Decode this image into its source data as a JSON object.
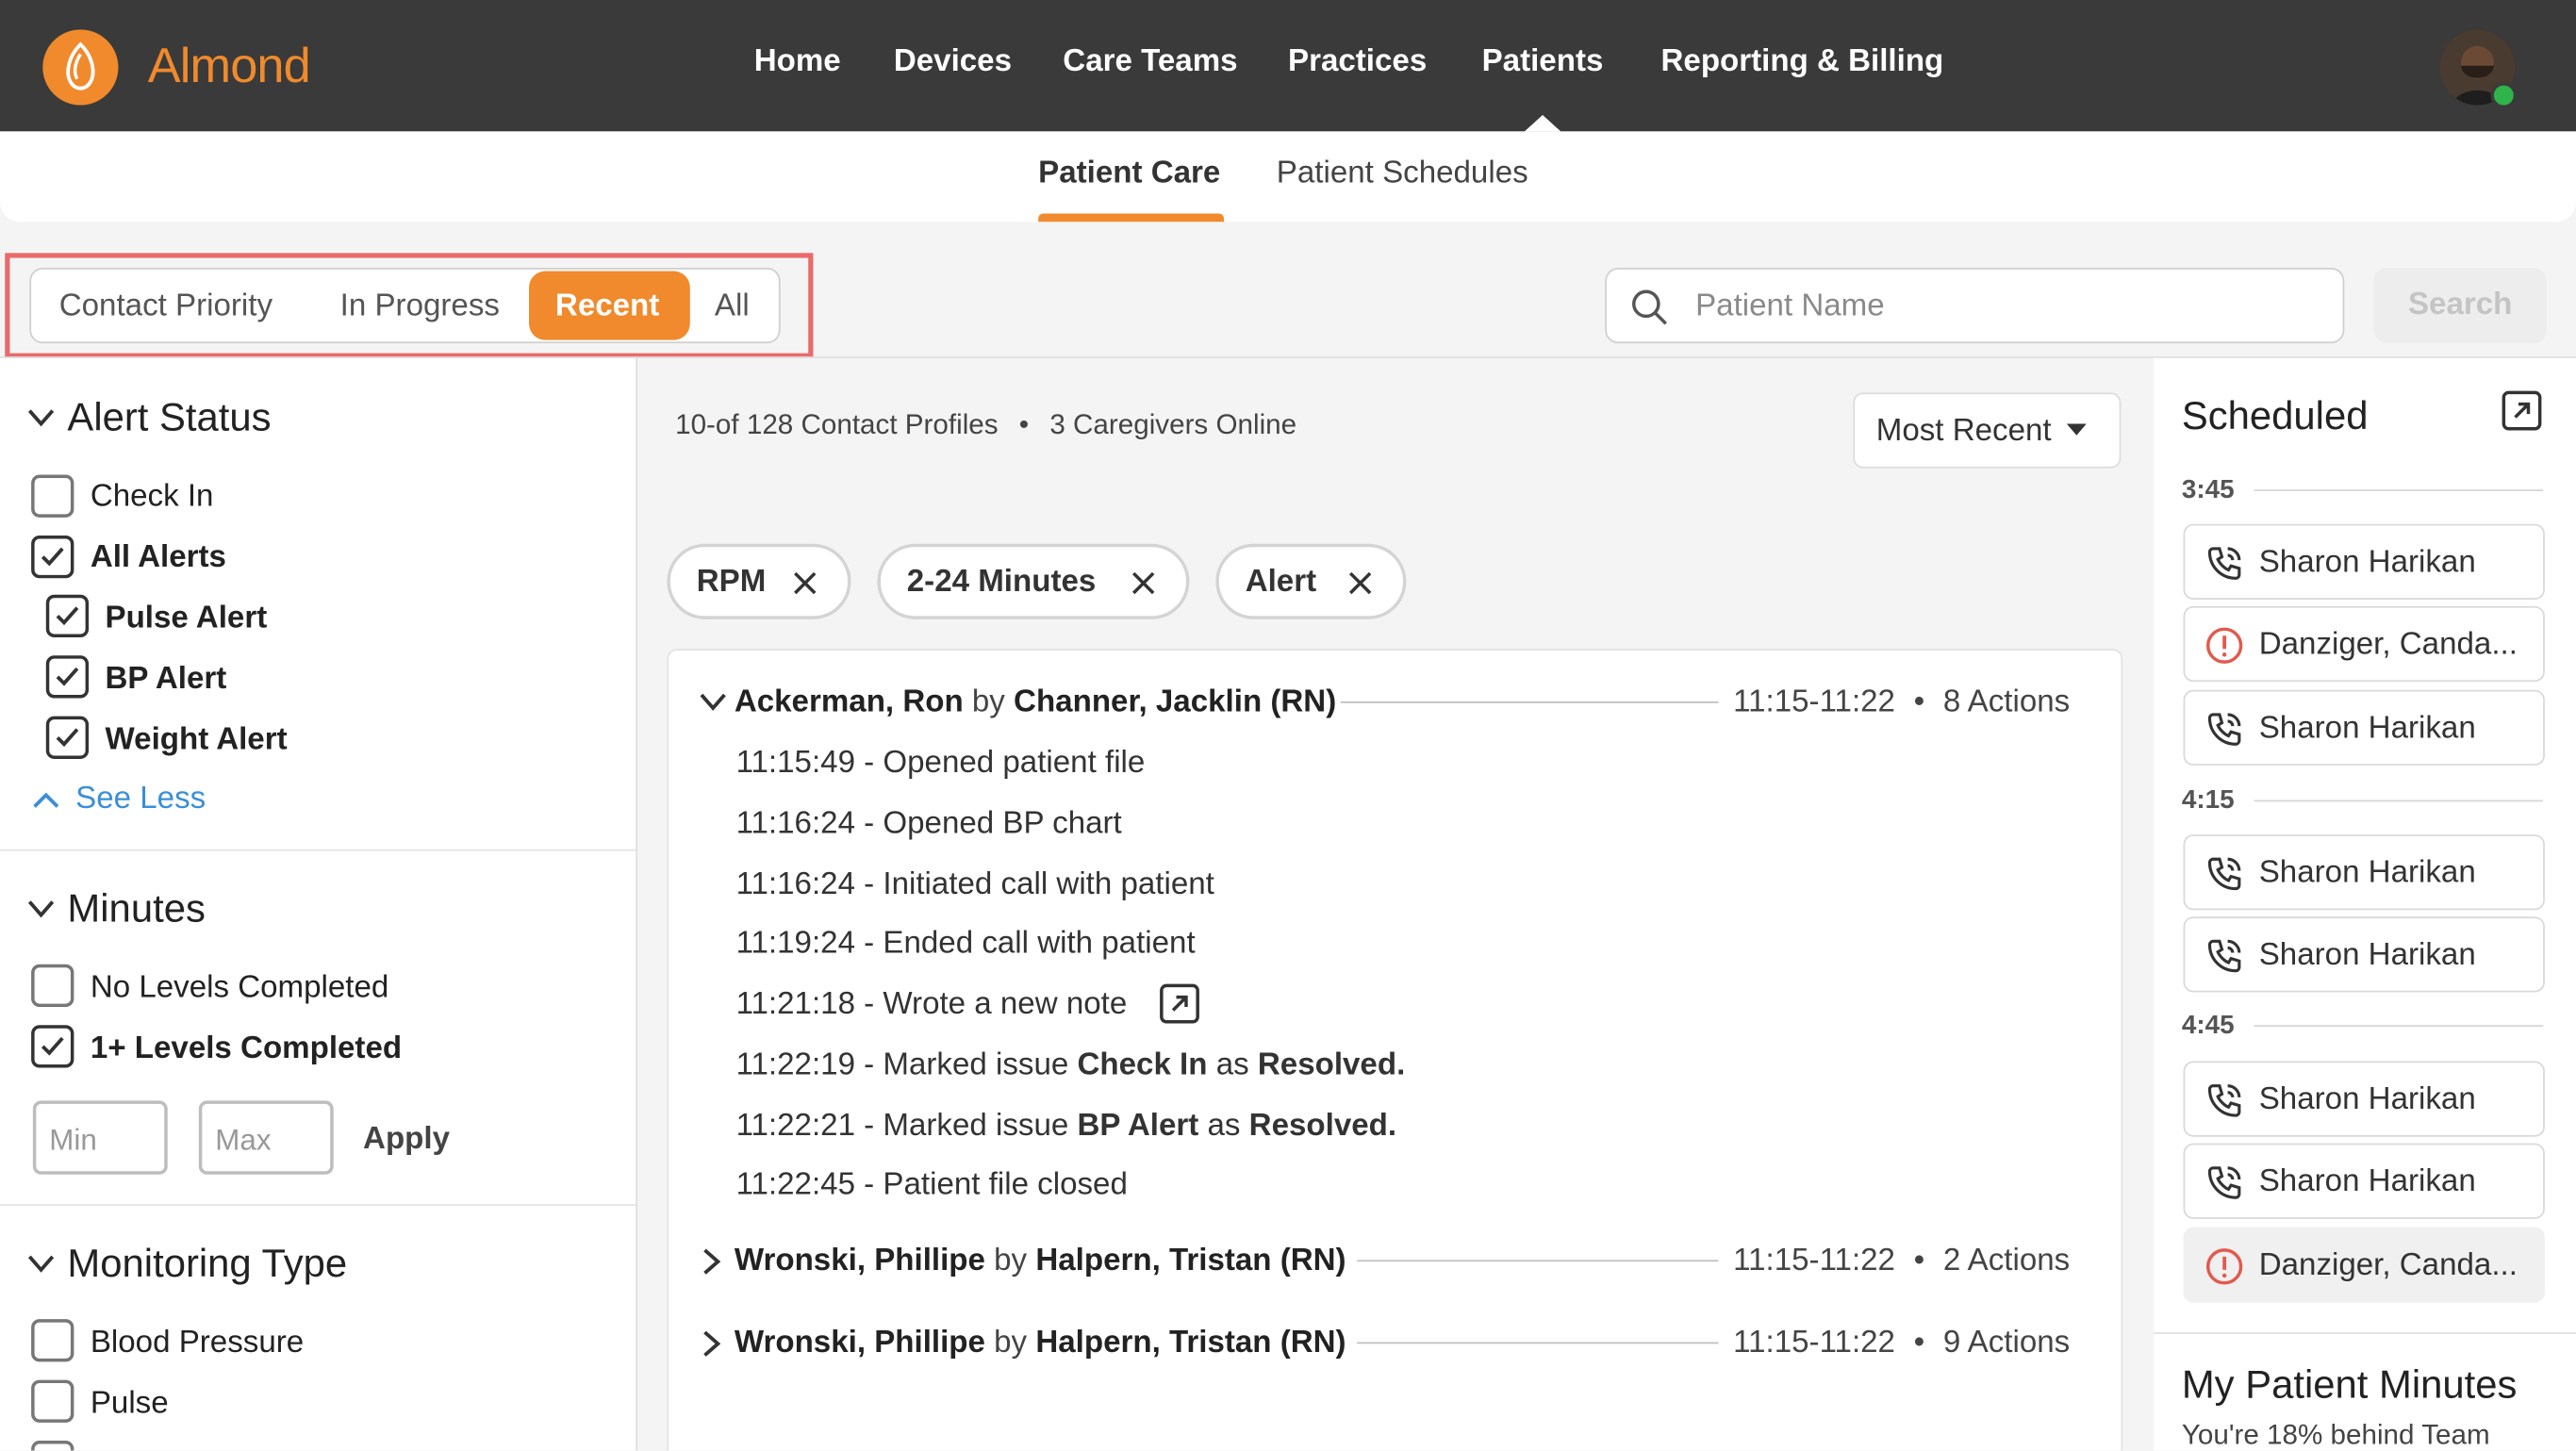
{
  "app": {
    "name": "Almond"
  },
  "nav": {
    "items": [
      "Home",
      "Devices",
      "Care Teams",
      "Practices",
      "Patients",
      "Reporting & Billing"
    ],
    "active": "Patients"
  },
  "subnav": {
    "tabs": [
      "Patient Care",
      "Patient Schedules"
    ],
    "active": "Patient Care"
  },
  "filter_tabs": {
    "items": [
      "Contact Priority",
      "In Progress",
      "Recent",
      "All"
    ],
    "active": "Recent"
  },
  "search": {
    "placeholder": "Patient Name",
    "button": "Search"
  },
  "alert_status": {
    "title": "Alert Status",
    "options": [
      {
        "label": "Check In",
        "checked": false
      },
      {
        "label": "All Alerts",
        "checked": true
      },
      {
        "label": "Pulse Alert",
        "checked": true
      },
      {
        "label": "BP Alert",
        "checked": true
      },
      {
        "label": "Weight Alert",
        "checked": true
      }
    ],
    "toggle": "See Less"
  },
  "minutes": {
    "title": "Minutes",
    "options": [
      {
        "label": "No Levels Completed",
        "checked": false
      },
      {
        "label": "1+ Levels Completed",
        "checked": true
      }
    ],
    "min_placeholder": "Min",
    "max_placeholder": "Max",
    "apply": "Apply"
  },
  "monitoring_type": {
    "title": "Monitoring Type",
    "options": [
      {
        "label": "Blood Pressure",
        "checked": false
      },
      {
        "label": "Pulse",
        "checked": false
      }
    ]
  },
  "summary": {
    "profiles": "10-of 128 Contact Profiles",
    "caregivers": "3 Caregivers Online"
  },
  "sort": {
    "label": "Most Recent"
  },
  "chips": [
    "RPM",
    "2-24 Minutes",
    "Alert"
  ],
  "logs": [
    {
      "patient": "Ackerman, Ron",
      "by": "by",
      "caregiver": "Channer, Jacklin (RN)",
      "time": "11:15-11:22",
      "actions": "8 Actions",
      "expanded": true,
      "entries": [
        {
          "text": "11:15:49 - Opened patient file"
        },
        {
          "text": "11:16:24 - Opened BP chart"
        },
        {
          "text": "11:16:24 - Initiated call with patient"
        },
        {
          "text": "11:19:24 - Ended call with patient"
        },
        {
          "text": "11:21:18 - Wrote a new note"
        },
        {
          "pre": "11:22:19 - Marked issue",
          "issue": "Check In",
          "mid": "as",
          "status": "Resolved."
        },
        {
          "pre": "11:22:21 - Marked issue",
          "issue": "BP Alert",
          "mid": "as",
          "status": "Resolved."
        },
        {
          "text": "11:22:45 - Patient file closed"
        }
      ]
    },
    {
      "patient": "Wronski, Phillipe",
      "by": "by",
      "caregiver": "Halpern, Tristan (RN)",
      "time": "11:15-11:22",
      "actions": "2 Actions",
      "expanded": false
    },
    {
      "patient": "Wronski, Phillipe",
      "by": "by",
      "caregiver": "Halpern, Tristan (RN)",
      "time": "11:15-11:22",
      "actions": "9 Actions",
      "expanded": false
    }
  ],
  "scheduled": {
    "title": "Scheduled",
    "groups": [
      {
        "time": "3:45",
        "items": [
          {
            "name": "Sharon Harikan",
            "icon": "phone-call-icon"
          },
          {
            "name": "Danziger, Canda...",
            "icon": "alert-circle-icon"
          },
          {
            "name": "Sharon Harikan",
            "icon": "phone-call-icon"
          }
        ]
      },
      {
        "time": "4:15",
        "items": [
          {
            "name": "Sharon Harikan",
            "icon": "phone-call-icon"
          },
          {
            "name": "Sharon Harikan",
            "icon": "phone-call-icon"
          }
        ]
      },
      {
        "time": "4:45",
        "items": [
          {
            "name": "Sharon Harikan",
            "icon": "phone-call-icon"
          },
          {
            "name": "Sharon Harikan",
            "icon": "phone-call-icon"
          },
          {
            "name": "Danziger, Canda...",
            "icon": "alert-circle-icon"
          }
        ]
      }
    ]
  },
  "patient_minutes": {
    "title": "My Patient Minutes",
    "subtitle": "You're 18% behind Team"
  },
  "colors": {
    "accent": "#f08a2c",
    "nav_bg": "#3a3a3a",
    "link": "#3b8fd6",
    "alert": "#e25a4e",
    "highlight": "#e96a6a"
  }
}
